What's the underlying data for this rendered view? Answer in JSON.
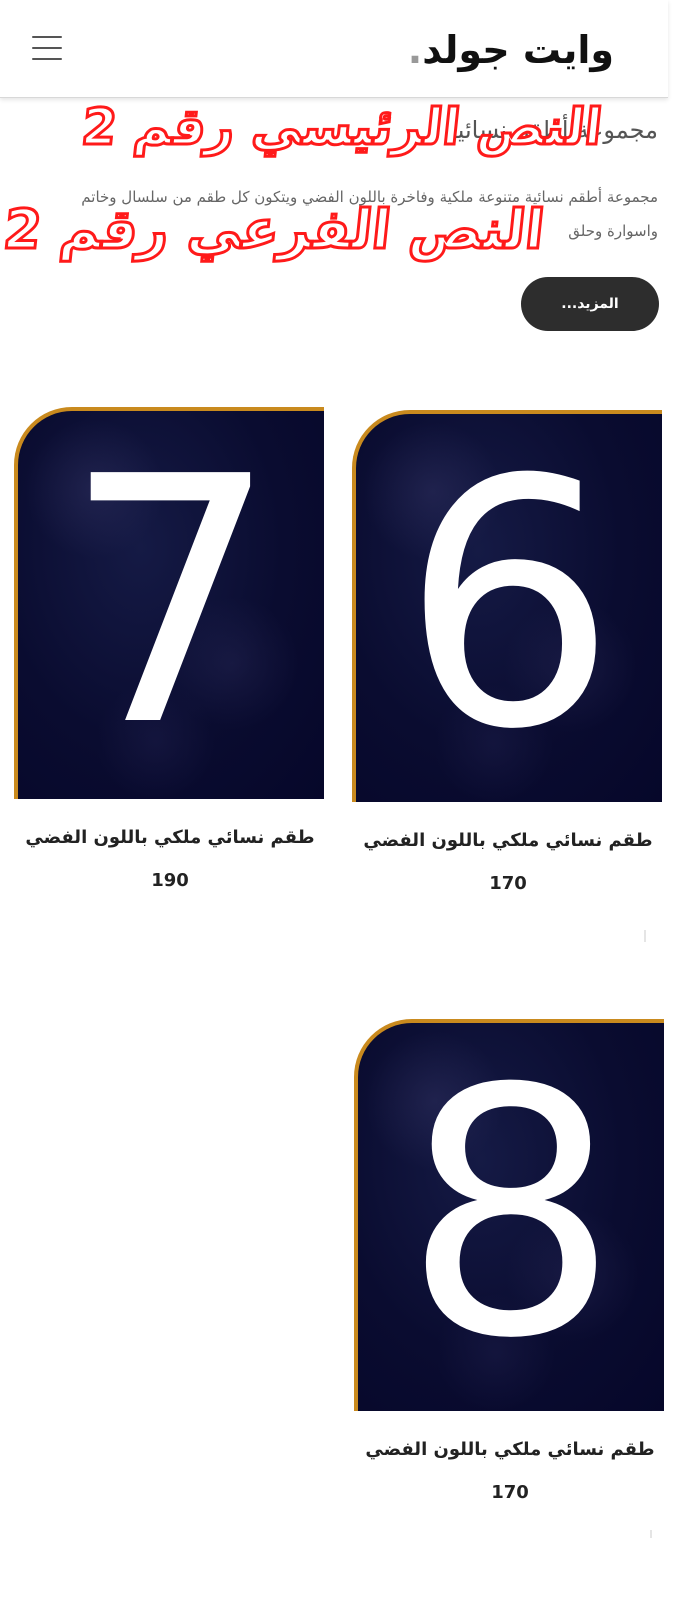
{
  "header": {
    "brand": "وايت جولد",
    "brand_dot": ".",
    "menu_icon": "hamburger-menu-icon"
  },
  "intro": {
    "title": "مجموعة أطقم نسائية",
    "text": "مجموعة أطقم نسائية متنوعة ملكية وفاخرة باللون الفضي ويتكون كل طقم من سلسال وخاتم واسوارة وحلق",
    "more_button": "المزيد..."
  },
  "overlay": {
    "main": "النص الرئيسي رقم 2",
    "sub": "النص الفرعي رقم 2",
    "color": "#ff1a1a"
  },
  "colors": {
    "accent_border": "#c98a1e",
    "card_bg": "#0a0c30",
    "button_bg": "#2d2d2d"
  },
  "products": [
    {
      "number": "6",
      "title": "طقم نسائي ملكي باللون الفضي",
      "price": "170"
    },
    {
      "number": "7",
      "title": "طقم نسائي ملكي باللون الفضي",
      "price": "190"
    },
    {
      "number": "8",
      "title": "طقم نسائي ملكي باللون الفضي",
      "price": "170"
    }
  ]
}
